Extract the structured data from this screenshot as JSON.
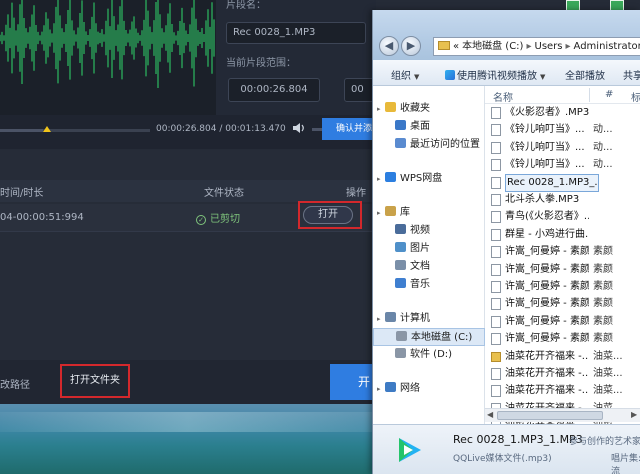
{
  "editor": {
    "segment_name_label": "片段名：",
    "segment_name_value": "Rec 0028_1.MP3",
    "range_label": "当前片段范围：",
    "range_start": "00:00:26.804",
    "range_end": "00",
    "time_current": "00:00:26.804",
    "time_total": "00:01:13.470",
    "time_separator": "/",
    "confirm_button": "确认并添",
    "table_headers": {
      "time": "时间/时长",
      "status": "文件状态",
      "action": "操作"
    },
    "row": {
      "time": "04-00:00:51:994",
      "status": "已剪切",
      "open_button": "打开"
    },
    "path_label": "改路径",
    "open_folder_button": "打开文件夹",
    "start_button": "开"
  },
  "explorer": {
    "address": [
      "本地磁盘 (C:)",
      "Users",
      "Administrator"
    ],
    "address_prefix": "«",
    "toolbar": {
      "organize": "组织",
      "play_with": "使用腾讯视频播放",
      "play_all": "全部播放",
      "share": "共享"
    },
    "columns": {
      "name": "名称",
      "num": "#",
      "title": "标"
    },
    "nav": [
      {
        "label": "收藏夹",
        "icon": "star-icon",
        "kind": "group"
      },
      {
        "label": "桌面",
        "icon": "desktop-icon",
        "kind": "item"
      },
      {
        "label": "最近访问的位置",
        "icon": "recent-icon",
        "kind": "item"
      },
      {
        "label": "WPS网盘",
        "icon": "cloud-icon",
        "kind": "group"
      },
      {
        "label": "库",
        "icon": "library-icon",
        "kind": "group"
      },
      {
        "label": "视频",
        "icon": "video-icon",
        "kind": "item"
      },
      {
        "label": "图片",
        "icon": "picture-icon",
        "kind": "item"
      },
      {
        "label": "文档",
        "icon": "document-icon",
        "kind": "item"
      },
      {
        "label": "音乐",
        "icon": "music-icon",
        "kind": "item"
      },
      {
        "label": "计算机",
        "icon": "computer-icon",
        "kind": "group"
      },
      {
        "label": "本地磁盘 (C:)",
        "icon": "drive-icon",
        "kind": "item"
      },
      {
        "label": "软件 (D:)",
        "icon": "drive-icon",
        "kind": "item"
      },
      {
        "label": "网络",
        "icon": "network-icon",
        "kind": "group"
      }
    ],
    "files": [
      {
        "name": "《火影忍者》.MP3",
        "extra": "",
        "folder": false
      },
      {
        "name": "《铃儿响叮当》...",
        "extra": "动...",
        "folder": false
      },
      {
        "name": "《铃儿响叮当》...",
        "extra": "动...",
        "folder": false
      },
      {
        "name": "《铃儿响叮当》...",
        "extra": "动...",
        "folder": false
      },
      {
        "name": "Rec 0028_1.MP3_...",
        "extra": "",
        "folder": false,
        "selected": true
      },
      {
        "name": "北斗杀人拳.MP3",
        "extra": "",
        "folder": false
      },
      {
        "name": "青鸟(《火影忍者》...",
        "extra": "",
        "folder": false
      },
      {
        "name": "群星 - 小鸡进行曲.M...",
        "extra": "",
        "folder": false
      },
      {
        "name": "许嵩_何曼婷 - 素颜...",
        "extra": "素颜",
        "folder": false
      },
      {
        "name": "许嵩_何曼婷 - 素颜...",
        "extra": "素颜",
        "folder": false
      },
      {
        "name": "许嵩_何曼婷 - 素颜...",
        "extra": "素颜",
        "folder": false
      },
      {
        "name": "许嵩_何曼婷 - 素颜...",
        "extra": "素颜",
        "folder": false
      },
      {
        "name": "许嵩_何曼婷 - 素颜...",
        "extra": "素颜",
        "folder": false
      },
      {
        "name": "许嵩_何曼婷 - 素颜...",
        "extra": "素颜",
        "folder": false
      },
      {
        "name": "油菜花开齐福来 -...",
        "extra": "油菜...",
        "folder": true
      },
      {
        "name": "油菜花开齐福来 -...",
        "extra": "油菜...",
        "folder": false
      },
      {
        "name": "油菜花开齐福来 -...",
        "extra": "油菜...",
        "folder": false
      },
      {
        "name": "油菜花开齐福来 -...",
        "extra": "油菜...",
        "folder": false
      },
      {
        "name": "油菜花开齐福来 -...",
        "extra": "油菜...",
        "folder": false
      }
    ],
    "details": {
      "name": "Rec 0028_1.MP3_1.MP3",
      "meta": "参与创作的艺术家",
      "type": "QQLive媒体文件(.mp3)",
      "extra": "唱片集:",
      "extra2": "流"
    }
  },
  "colors": {
    "accent_blue": "#2f7de1",
    "highlight_red": "#d3282c",
    "status_green": "#7fc47c",
    "wave_green": "#2fd86a"
  }
}
